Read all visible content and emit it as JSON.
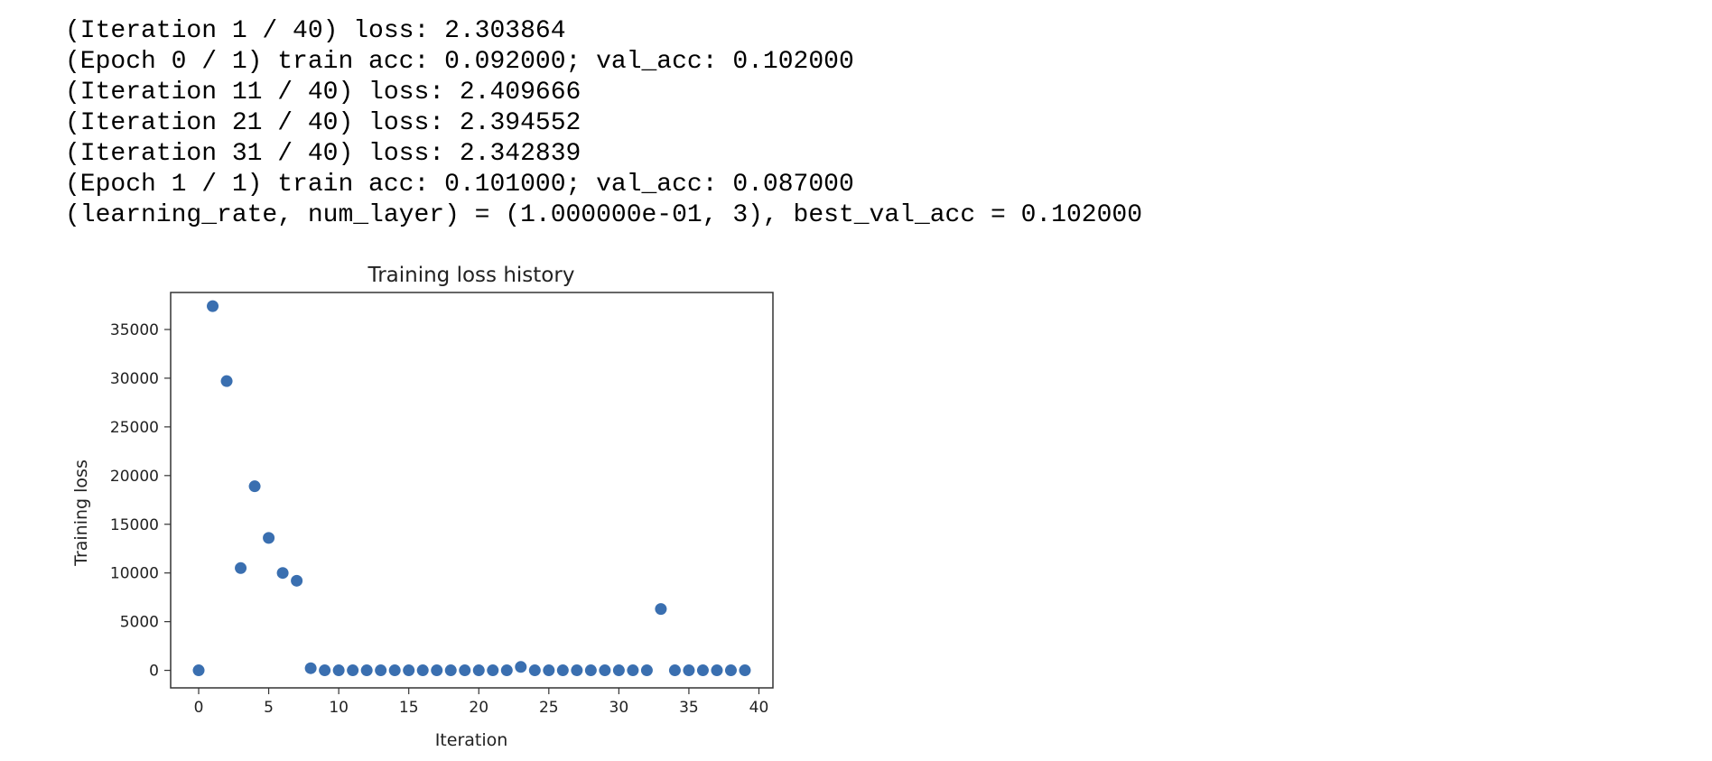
{
  "console": {
    "lines": [
      "(Iteration 1 / 40) loss: 2.303864",
      "(Epoch 0 / 1) train acc: 0.092000; val_acc: 0.102000",
      "(Iteration 11 / 40) loss: 2.409666",
      "(Iteration 21 / 40) loss: 2.394552",
      "(Iteration 31 / 40) loss: 2.342839",
      "(Epoch 1 / 1) train acc: 0.101000; val_acc: 0.087000",
      "(learning_rate, num_layer) = (1.000000e-01, 3), best_val_acc = 0.102000"
    ]
  },
  "chart_data": {
    "type": "scatter",
    "title": "Training loss history",
    "xlabel": "Iteration",
    "ylabel": "Training loss",
    "xlim": [
      -2,
      41
    ],
    "ylim": [
      -1800,
      38800
    ],
    "xticks": [
      0,
      5,
      10,
      15,
      20,
      25,
      30,
      35,
      40
    ],
    "yticks": [
      0,
      5000,
      10000,
      15000,
      20000,
      25000,
      30000,
      35000
    ],
    "grid": false,
    "point_color": "#3a6fb0",
    "x": [
      0,
      1,
      2,
      3,
      4,
      5,
      6,
      7,
      8,
      9,
      10,
      11,
      12,
      13,
      14,
      15,
      16,
      17,
      18,
      19,
      20,
      21,
      22,
      23,
      24,
      25,
      26,
      27,
      28,
      29,
      30,
      31,
      32,
      33,
      34,
      35,
      36,
      37,
      38,
      39
    ],
    "y": [
      2.3,
      37400,
      29700,
      10500,
      18900,
      13600,
      10000,
      9200,
      220,
      3,
      3,
      3,
      3,
      3,
      3,
      3,
      3,
      3,
      3,
      3,
      3,
      3,
      3,
      350,
      3,
      3,
      3,
      3,
      3,
      3,
      3,
      3,
      3,
      6300,
      3,
      3,
      3,
      3,
      3,
      3
    ]
  }
}
